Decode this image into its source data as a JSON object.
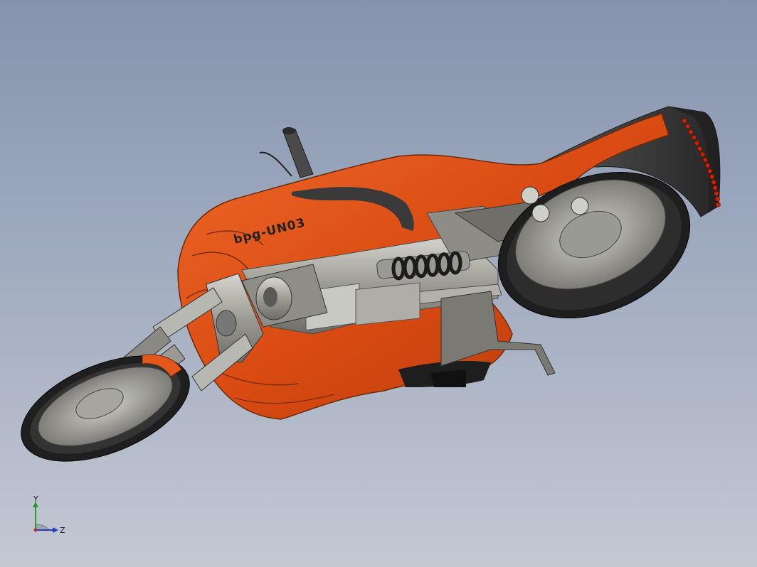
{
  "model": {
    "name_decal": "bpg-UN03"
  },
  "triad": {
    "y_label": "Y",
    "z_label": "Z"
  },
  "colors": {
    "background_top": "#8593ad",
    "background_bottom": "#c3c8d3",
    "body": "#e3571b",
    "frame": "#9c9b93",
    "tire": "#232323",
    "accent_dark": "#2f2f2f",
    "rear_light": "#cc2200"
  }
}
